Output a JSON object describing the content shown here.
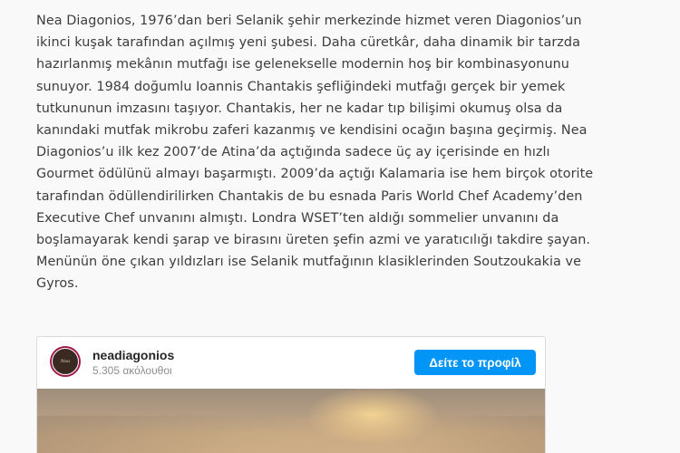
{
  "article": {
    "lines": [
      "Nea Diagonios, 1976’dan beri Selanik şehir merkezinde hizmet veren Diagonios’un",
      "ikinci kuşak tarafından açılmış yeni şubesi. Daha cüretkâr, daha dinamik bir tarzda",
      "hazırlanmış mekânın mutfağı ise gelenekselle modernin hoş bir kombinasyonunu",
      "sunuyor. 1984 doğumlu Ioannis Chantakis şefliğindeki mutfağı gerçek bir yemek",
      "tutkununun imzasını taşıyor. Chantakis, her ne kadar tıp bilişimi okumuş olsa da",
      "kanındaki mutfak mikrobu zaferi kazanmış ve kendisini ocağın başına geçirmiş. Nea",
      "Diagonios’u ilk kez 2007’de Atina’da açtığında sadece üç ay içerisinde en hızlı",
      "Gourmet ödülünü almayı başarmıştı. 2009’da açtığı Kalamaria ise hem birçok otorite",
      "tarafından ödüllendirilirken Chantakis de bu esnada Paris World Chef Academy’den",
      "Executive Chef unvanını almıştı. Londra WSET’ten aldığı sommelier unvanını da",
      "boşlamayarak kendi şarap ve birasını üreten şefin azmi ve yaratıcılığı takdire şayan.",
      "Menünün öne çıkan yıldızları ise Selanik mutfağının klasiklerinden Soutzoukakia ve",
      "Gyros."
    ]
  },
  "instagram_embed": {
    "username": "neadiagonios",
    "followers": "5.305 ακόλουθοι",
    "profile_button": "Δείτε το προφίλ",
    "avatar_icon": "restaurant-logo-icon",
    "accent_color": "#0095f6"
  }
}
